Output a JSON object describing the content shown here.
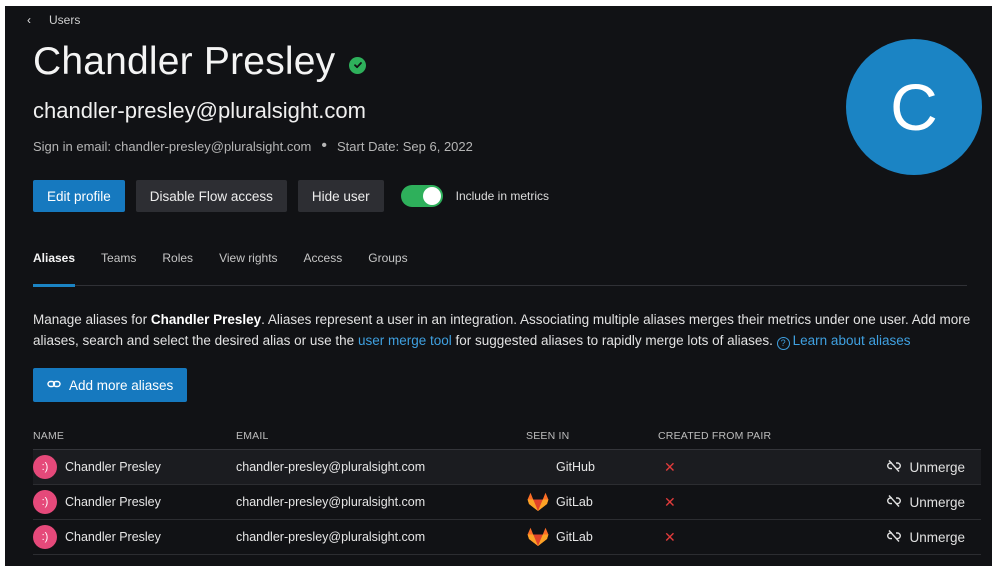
{
  "nav": {
    "back_label": "Users"
  },
  "user": {
    "name": "Chandler Presley",
    "email": "chandler-presley@pluralsight.com",
    "sign_in_email": "Sign in email: chandler-presley@pluralsight.com",
    "start_date": "Start Date: Sep 6, 2022",
    "avatar_initial": "C"
  },
  "actions": {
    "edit_profile": "Edit profile",
    "disable_flow": "Disable Flow access",
    "hide_user": "Hide user",
    "include_metrics": "Include in metrics",
    "include_metrics_on": true
  },
  "tabs": [
    {
      "label": "Aliases",
      "active": true
    },
    {
      "label": "Teams"
    },
    {
      "label": "Roles"
    },
    {
      "label": "View rights"
    },
    {
      "label": "Access"
    },
    {
      "label": "Groups"
    }
  ],
  "description": {
    "p1": "Manage aliases for ",
    "name": "Chandler Presley",
    "p2": ". Aliases represent a user in an integration. Associating multiple aliases merges their metrics under one user. Add more aliases, search and select the desired alias or use the ",
    "merge_link": "user merge tool",
    "p3": " for suggested aliases to rapidly merge lots of aliases. ",
    "learn_link": "Learn about aliases"
  },
  "add_aliases_label": "Add more aliases",
  "table": {
    "headers": {
      "name": "NAME",
      "email": "EMAIL",
      "seen_in": "SEEN IN",
      "created_from_pair": "CREATED FROM PAIR"
    },
    "rows": [
      {
        "name": "Chandler Presley",
        "email": "chandler-presley@pluralsight.com",
        "seen_in": "GitHub",
        "seen_icon": "github-icon",
        "created_from_pair": "✕",
        "action": "Unmerge",
        "avatar": ":)"
      },
      {
        "name": "Chandler Presley",
        "email": "chandler-presley@pluralsight.com",
        "seen_in": "GitLab",
        "seen_icon": "gitlab-icon",
        "created_from_pair": "✕",
        "action": "Unmerge",
        "avatar": ":)"
      },
      {
        "name": "Chandler Presley",
        "email": "chandler-presley@pluralsight.com",
        "seen_in": "GitLab",
        "seen_icon": "gitlab-icon",
        "created_from_pair": "✕",
        "action": "Unmerge",
        "avatar": ":)"
      }
    ]
  },
  "colors": {
    "accent": "#1679bf",
    "toggle_on": "#2eb05b",
    "avatar_big": "#1b84c4",
    "avatar_small": "#e5497a",
    "error": "#e23b3b"
  }
}
